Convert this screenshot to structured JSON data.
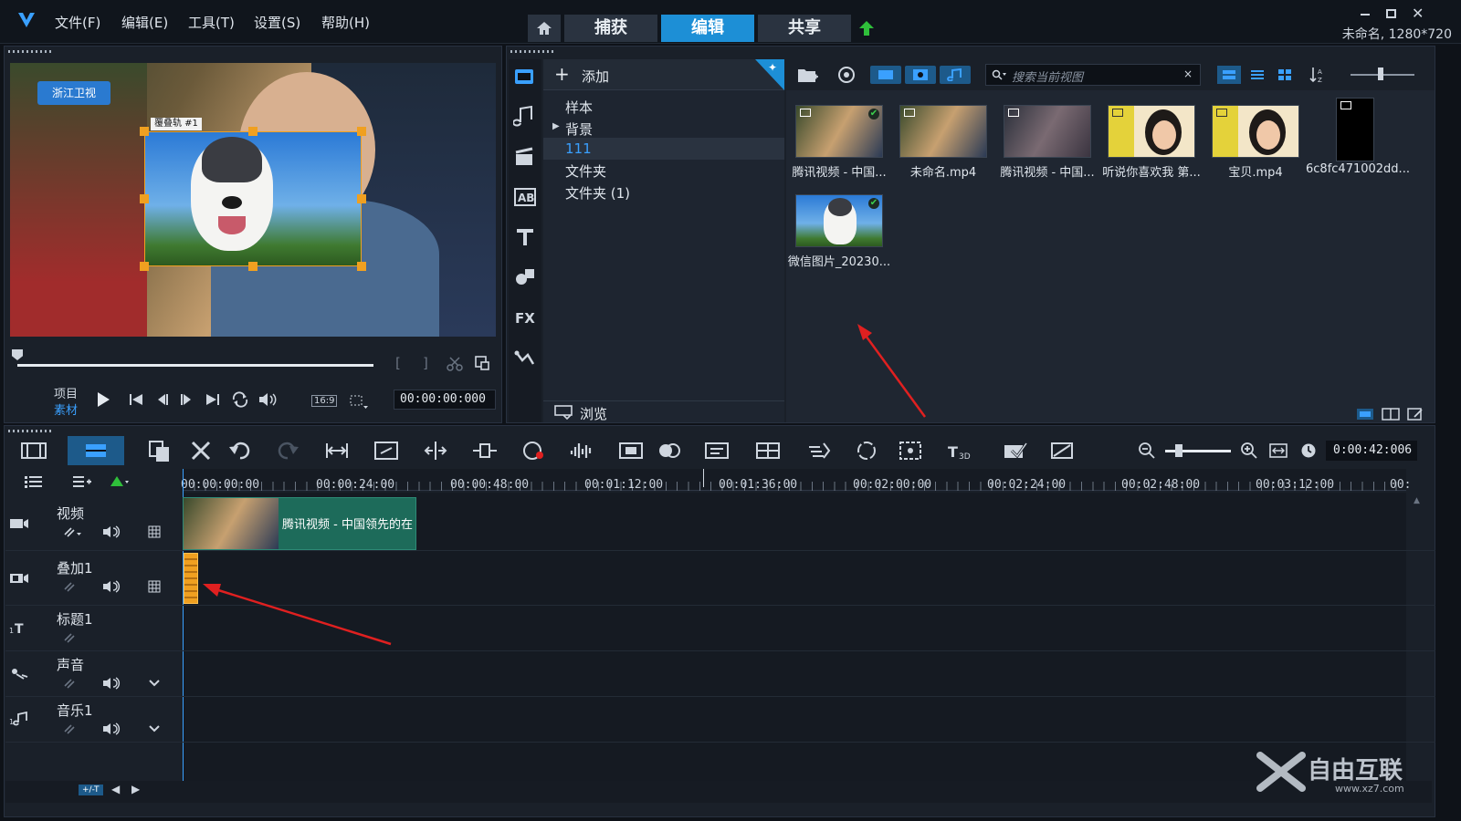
{
  "menu": [
    "文件(F)",
    "编辑(E)",
    "工具(T)",
    "设置(S)",
    "帮助(H)"
  ],
  "modes": {
    "capture": "捕获",
    "edit": "编辑",
    "share": "共享"
  },
  "project_info": "未命名, 1280*720",
  "preview": {
    "overlay_label": "覆叠轨 #1",
    "watermark_text": "浙江卫视",
    "project_label": "项目",
    "clip_label": "素材",
    "aspect": "16:9",
    "timecode": "00:00:00:000"
  },
  "library": {
    "add_label": "添加",
    "folders": [
      "样本",
      "背景",
      "111",
      "文件夹",
      "文件夹 (1)"
    ],
    "selected_folder": "111",
    "browse_label": "浏览",
    "search_placeholder": "搜索当前视图"
  },
  "media": [
    {
      "caption": "腾讯视频 - 中国...",
      "checked": true
    },
    {
      "caption": "未命名.mp4",
      "checked": false
    },
    {
      "caption": "腾讯视频 - 中国...",
      "checked": false
    },
    {
      "caption": "听说你喜欢我 第...",
      "checked": false
    },
    {
      "caption": "宝贝.mp4",
      "checked": false
    },
    {
      "caption": "6c8fc471002dd...",
      "checked": false
    },
    {
      "caption": "微信图片_20230...",
      "checked": true
    }
  ],
  "timeline": {
    "duration": "0:00:42:006",
    "ruler": [
      "00:00:00:00",
      "00:00:24:00",
      "00:00:48:00",
      "00:01:12:00",
      "00:01:36:00",
      "00:02:00:00",
      "00:02:24:00",
      "00:02:48:00",
      "00:03:12:00",
      "00:"
    ],
    "tracks": [
      {
        "name": "视频"
      },
      {
        "name": "叠加1"
      },
      {
        "name": "标题1"
      },
      {
        "name": "声音"
      },
      {
        "name": "音乐1"
      }
    ],
    "video_clip_label": "腾讯视频 - 中国领先的在"
  },
  "footer": {
    "fit_label": "+/-T"
  },
  "brand": {
    "name": "自由互联",
    "url": "www.xz7.com"
  },
  "colors": {
    "accent": "#1d8fd6",
    "overlay_handle": "#f0a020",
    "clip_green": "#1d6b5a",
    "arrow": "#e02020"
  }
}
